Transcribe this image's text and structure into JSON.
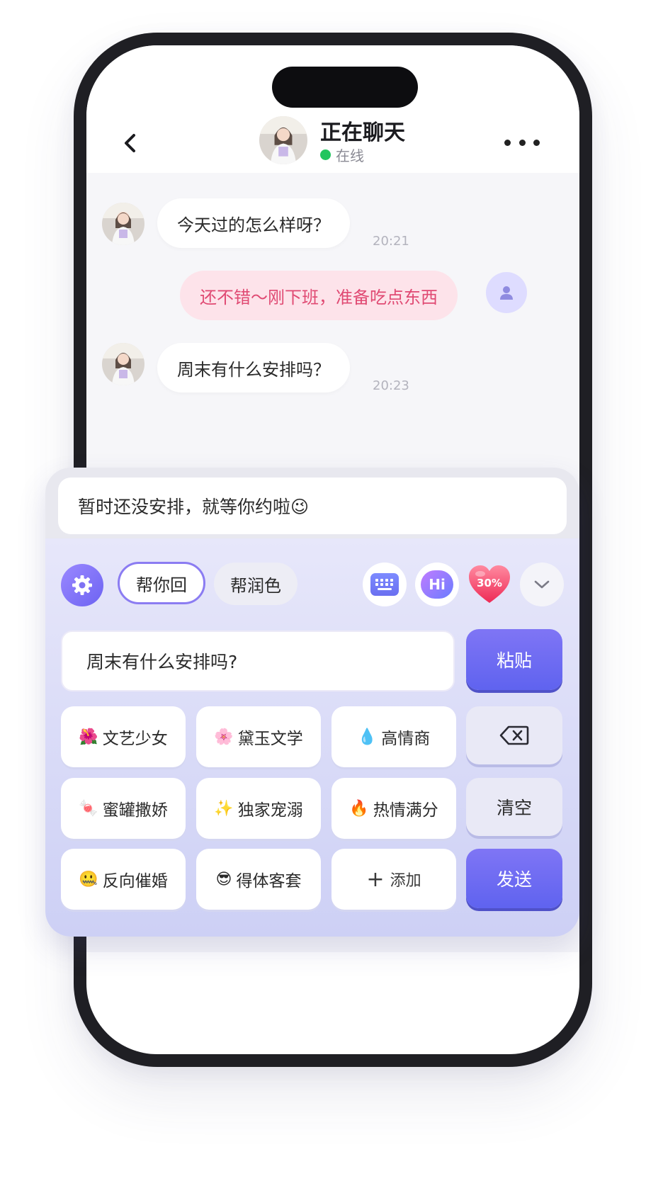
{
  "header": {
    "title": "正在聊天",
    "status": "在线"
  },
  "messages": [
    {
      "side": "in",
      "text": "今天过的怎么样呀？",
      "time": "20:21"
    },
    {
      "side": "out",
      "text": "还不错～刚下班，准备吃点东西"
    },
    {
      "side": "in",
      "text": "周末有什么安排吗？",
      "time": "20:23"
    }
  ],
  "assistant": {
    "generated_reply": "暂时还没安排，就等你约啦😉",
    "modes": [
      "帮你回",
      "帮润色"
    ],
    "active_mode": "帮你回",
    "heart_badge": "30%",
    "hi_badge": "Hi",
    "source_text": "周末有什么安排吗?",
    "paste_label": "粘贴",
    "clear_label": "清空",
    "send_label": "发送",
    "add_label": "添加",
    "styles": [
      {
        "emoji": "🌺",
        "label": "文艺少女"
      },
      {
        "emoji": "🌸",
        "label": "黛玉文学"
      },
      {
        "emoji": "💧",
        "label": "高情商"
      },
      {
        "emoji": "🍬",
        "label": "蜜罐撒娇"
      },
      {
        "emoji": "✨",
        "label": "独家宠溺"
      },
      {
        "emoji": "🔥",
        "label": "热情满分"
      },
      {
        "emoji": "🤐",
        "label": "反向催婚"
      },
      {
        "emoji": "😎",
        "label": "得体客套"
      }
    ]
  },
  "colors": {
    "accent": "#6d63f2",
    "outgoing_bubble": "#fde3ea",
    "outgoing_text": "#e04a73",
    "online": "#22c55e"
  },
  "icons": [
    "back-chevron-icon",
    "more-dots-icon",
    "user-icon",
    "gear-icon",
    "keyboard-icon",
    "hi-bubble-icon",
    "heart-icon",
    "chevron-down-icon",
    "backspace-icon",
    "plus-icon"
  ]
}
